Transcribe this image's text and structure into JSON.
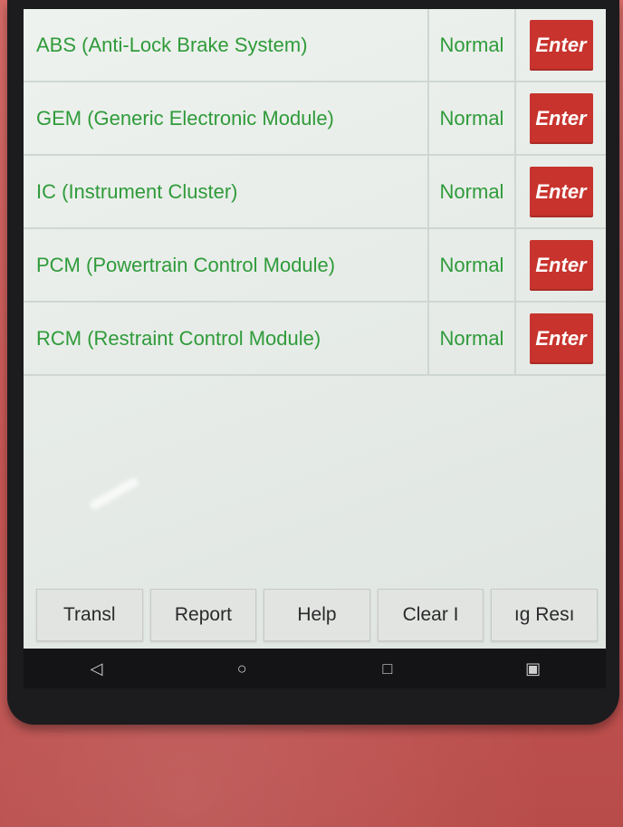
{
  "modules": [
    {
      "name": "ABS (Anti-Lock Brake System)",
      "status": "Normal",
      "action": "Enter"
    },
    {
      "name": "GEM (Generic Electronic Module)",
      "status": "Normal",
      "action": "Enter"
    },
    {
      "name": "IC (Instrument Cluster)",
      "status": "Normal",
      "action": "Enter"
    },
    {
      "name": "PCM (Powertrain Control Module)",
      "status": "Normal",
      "action": "Enter"
    },
    {
      "name": "RCM (Restraint Control Module)",
      "status": "Normal",
      "action": "Enter"
    }
  ],
  "toolbar": {
    "translate_label": "Transl",
    "report_label": "Report",
    "help_label": "Help",
    "clear_label": "Clear I",
    "reset_label": "ıg    Resı"
  },
  "navbar": {
    "back_glyph": "◁",
    "home_glyph": "○",
    "recents_glyph": "□",
    "screenshot_glyph": "▣"
  },
  "colors": {
    "text_green": "#2f9b3a",
    "enter_red": "#c8332d",
    "case_red": "#c85a58"
  }
}
